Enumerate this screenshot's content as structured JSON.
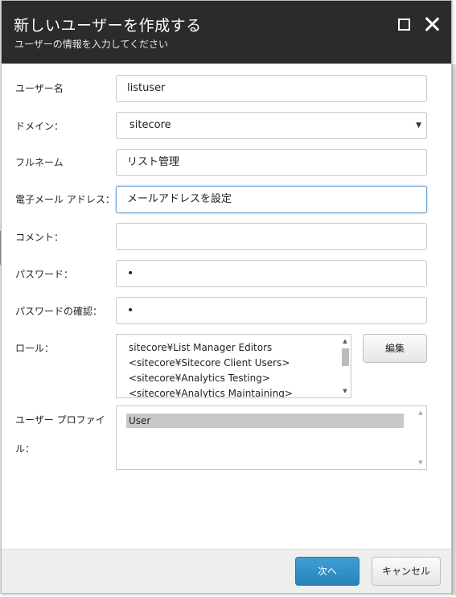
{
  "dialog": {
    "title": "新しいユーザーを作成する",
    "subtitle": "ユーザーの情報を入力してください",
    "maximize_icon": "maximize-icon",
    "close_icon": "close-icon"
  },
  "form": {
    "username": {
      "label": "ユーザー名",
      "value": "listuser"
    },
    "domain": {
      "label": "ドメイン：",
      "value": "sitecore"
    },
    "fullname": {
      "label": "フルネーム",
      "value": "リスト管理"
    },
    "email": {
      "label": "電子メール アドレス：",
      "value": "メールアドレスを設定"
    },
    "comment": {
      "label": "コメント：",
      "value": ""
    },
    "password": {
      "label": "パスワード：",
      "value": "•"
    },
    "password_confirm": {
      "label": "パスワードの確認：",
      "value": "•"
    },
    "roles": {
      "label": "ロール：",
      "items": [
        "sitecore¥List Manager Editors",
        "<sitecore¥Sitecore Client Users>",
        "<sitecore¥Analytics Testing>",
        "<sitecore¥Analytics Maintaining>"
      ],
      "edit_label": "編集"
    },
    "profile": {
      "label_line1": "ユーザー プロファイ",
      "label_line2": "ル：",
      "selected": "User"
    }
  },
  "footer": {
    "next_label": "次へ",
    "cancel_label": "キャンセル"
  },
  "colors": {
    "titlebar": "#2b2b2b",
    "primary_button": "#2e8cc2",
    "focus_border": "#6aa3d8"
  }
}
